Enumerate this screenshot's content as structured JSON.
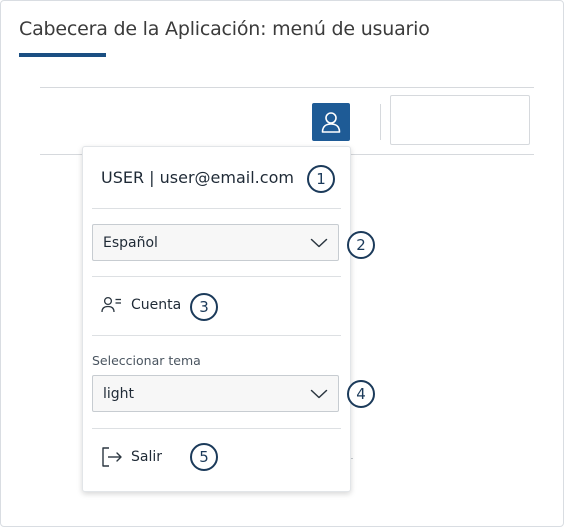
{
  "page": {
    "title": "Cabecera de la Aplicación: menú de usuario"
  },
  "header": {
    "user_button_icon": "user-icon"
  },
  "menu": {
    "user_line": "USER | user@email.com",
    "language": {
      "value": "Español",
      "icon": "chevron-down-icon"
    },
    "account": {
      "label": "Cuenta",
      "icon": "account-icon"
    },
    "theme": {
      "label": "Seleccionar tema",
      "value": "light",
      "icon": "chevron-down-icon"
    },
    "logout": {
      "label": "Salir",
      "icon": "logout-icon"
    }
  },
  "callouts": [
    "1",
    "2",
    "3",
    "4",
    "5"
  ],
  "colors": {
    "accent": "#1e5b96",
    "title_underline": "#1b4f82",
    "badge": "#1b3a5a"
  }
}
